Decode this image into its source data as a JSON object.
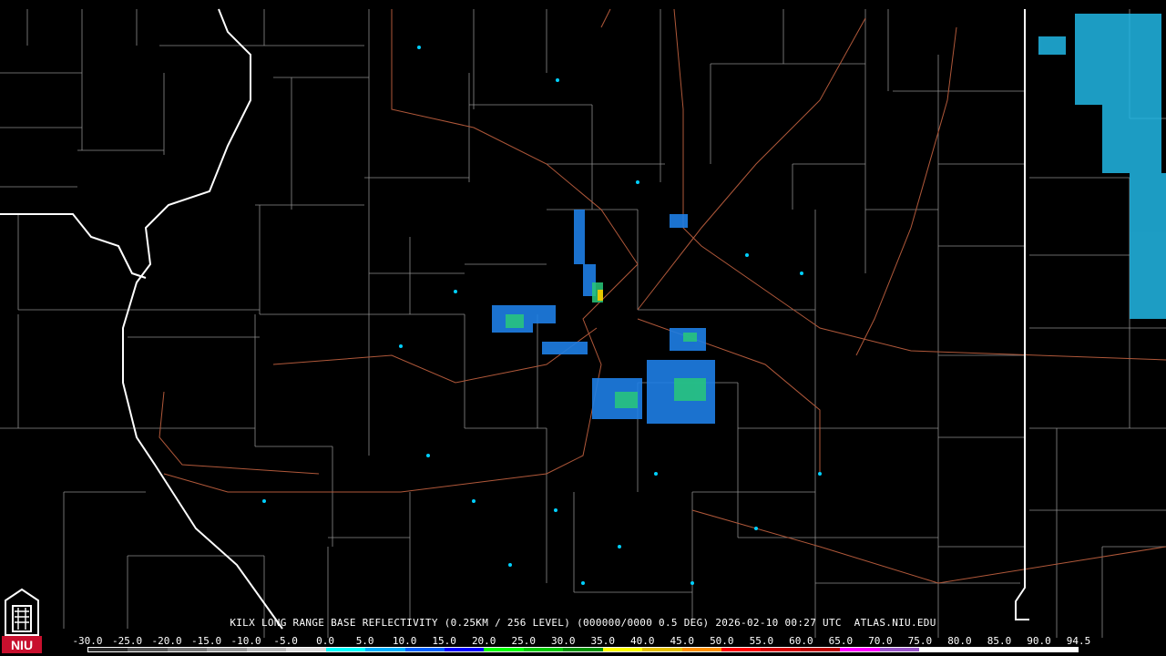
{
  "title": {
    "line": "KILX LONG RANGE BASE REFLECTIVITY (0.25KM / 256 LEVEL) (000000/0000 0.5 DEG) 2026-02-10 00:27 UTC  ATLAS.NIU.EDU"
  },
  "scale": {
    "labels": [
      "-30.0",
      "-25.0",
      "-20.0",
      "-15.0",
      "-10.0",
      "-5.0",
      "0.0",
      "5.0",
      "10.0",
      "15.0",
      "20.0",
      "25.0",
      "30.0",
      "35.0",
      "40.0",
      "45.0",
      "50.0",
      "55.0",
      "60.0",
      "65.0",
      "70.0",
      "75.0",
      "80.0",
      "85.0",
      "90.0",
      "94.5"
    ],
    "colors": [
      "#2a2a2a",
      "#555555",
      "#777777",
      "#999999",
      "#bbbbbb",
      "#dddddd",
      "#00ffff",
      "#00b0ff",
      "#0060ff",
      "#0000ff",
      "#00ff00",
      "#00c800",
      "#009000",
      "#ffff00",
      "#e6c000",
      "#ff9000",
      "#ff0000",
      "#d40000",
      "#bc0000",
      "#ff00ff",
      "#9955c9",
      "#ffffff",
      "#ffffff",
      "#ffffff",
      "#ffffff"
    ]
  },
  "logo": {
    "text": "NIU",
    "name": "niu-logo"
  },
  "colors": {
    "background": "#000000",
    "county_lines": "#8c8c8c",
    "state_lines": "#ffffff",
    "highways": "#b0583a"
  }
}
